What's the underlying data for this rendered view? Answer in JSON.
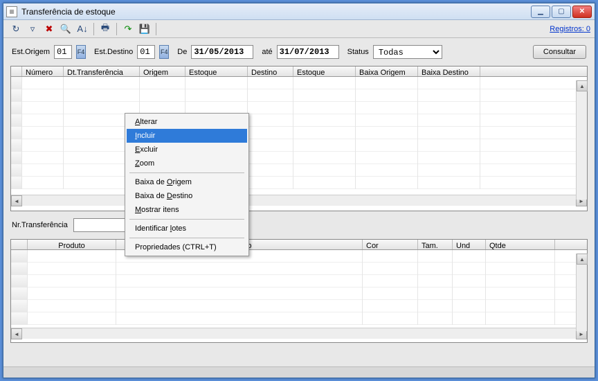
{
  "window": {
    "title": "Transferência de estoque"
  },
  "toolbar": {
    "registros_label": "Registros:",
    "registros_count": 0
  },
  "filters": {
    "est_origem_label": "Est.Origem",
    "est_origem_value": "01",
    "est_destino_label": "Est.Destino",
    "est_destino_value": "01",
    "de_label": "De",
    "de_value": "31/05/2013",
    "ate_label": "até",
    "ate_value": "31/07/2013",
    "status_label": "Status",
    "status_value": "Todas",
    "consultar_label": "Consultar"
  },
  "grid1": {
    "columns": [
      "Número",
      "Dt.Transferência",
      "Origem",
      "Estoque",
      "Destino",
      "Estoque",
      "Baixa Origem",
      "Baixa Destino"
    ],
    "widths": [
      16,
      60,
      110,
      66,
      90,
      66,
      90,
      90,
      90,
      132
    ]
  },
  "nr_transf_label": "Nr.Transferência",
  "grid2": {
    "columns": [
      "Produto",
      "Modelo",
      "Cor",
      "Tam.",
      "Und",
      "Qtde"
    ],
    "widths": [
      24,
      128,
      356,
      80,
      50,
      48,
      100,
      18
    ]
  },
  "context_menu": {
    "items": [
      {
        "label": "Alterar",
        "u": "A"
      },
      {
        "label": "Incluir",
        "u": "I",
        "selected": true
      },
      {
        "label": "Excluir",
        "u": "E"
      },
      {
        "label": "Zoom",
        "u": "Z"
      },
      {
        "sep": true
      },
      {
        "label": "Baixa de Origem",
        "u": "O",
        "usuf": true
      },
      {
        "label": "Baixa de Destino",
        "u": "D",
        "usuf": true
      },
      {
        "label": "Mostrar itens",
        "u": "M"
      },
      {
        "sep": true
      },
      {
        "label": "Identificar lotes",
        "u": "l",
        "mid": true
      },
      {
        "sep": true
      },
      {
        "label": "Propriedades (CTRL+T)"
      }
    ]
  }
}
